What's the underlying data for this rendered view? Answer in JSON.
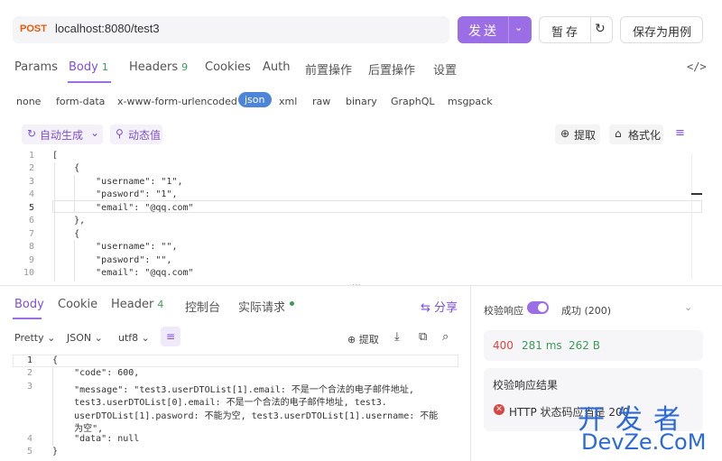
{
  "request": {
    "method": "POST",
    "url": "localhost:8080/test3",
    "send_label": "发送",
    "save_label": "暂存",
    "save_as_label": "保存为用例"
  },
  "tabs": [
    {
      "label": "Params"
    },
    {
      "label": "Body",
      "badge": "1"
    },
    {
      "label": "Headers",
      "badge": "9"
    },
    {
      "label": "Cookies"
    },
    {
      "label": "Auth"
    },
    {
      "label": "前置操作"
    },
    {
      "label": "后置操作"
    },
    {
      "label": "设置"
    }
  ],
  "body_types": [
    "none",
    "form-data",
    "x-www-form-urlencoded",
    "json",
    "xml",
    "raw",
    "binary",
    "GraphQL",
    "msgpack"
  ],
  "body_selected": "json",
  "tools": {
    "auto_gen": "自动生成",
    "dynamic": "动态值",
    "extract": "提取",
    "format": "格式化"
  },
  "editor": {
    "line_numbers": [
      "1",
      "2",
      "3",
      "4",
      "5",
      "6",
      "7",
      "8",
      "9",
      "10"
    ],
    "lines": [
      "[",
      "    {",
      "        \"username\": \"1\",",
      "        \"pasword\": \"1\",",
      "        \"email\": \"@qq.com\"",
      "    },",
      "    {",
      "        \"username\": \"\",",
      "        \"pasword\": \"\",",
      "        \"email\": \"@qq.com\""
    ]
  },
  "response_tabs": [
    {
      "label": "Body"
    },
    {
      "label": "Cookie"
    },
    {
      "label": "Header",
      "badge": "4"
    },
    {
      "label": "控制台"
    },
    {
      "label": "实际请求"
    }
  ],
  "share_label": "分享",
  "response_opts": {
    "pretty": "Pretty",
    "format": "JSON",
    "encoding": "utf8",
    "extract": "提取"
  },
  "response": {
    "line_numbers": [
      "1",
      "2",
      "3",
      "",
      "",
      "",
      "4",
      "5"
    ],
    "lines": [
      "{",
      "    \"code\": 600,",
      "    \"message\": \"test3.userDTOList[1].email: 不是一个合法的电子邮件地址,",
      "    test3.userDTOList[0].email: 不是一个合法的电子邮件地址, test3.",
      "    userDTOList[1].pasword: 不能为空, test3.userDTOList[1].username: 不能",
      "    为空\",",
      "    \"data\": null",
      "}"
    ]
  },
  "validate": {
    "label": "校验响应",
    "status": "成功 (200)",
    "code": "400",
    "time": "281 ms",
    "size": "262 B",
    "result_title": "校验响应结果",
    "result_text": "HTTP 状态码应当是 200"
  },
  "watermark": {
    "cn": "开发者",
    "en": "DevZe.CoM"
  },
  "colors": {
    "accent": "#9b6ee6",
    "method": "#e8590c",
    "error": "#d9463f",
    "code": "#d9463f",
    "time": "#3b9c5a",
    "size": "#3b9c5a"
  }
}
